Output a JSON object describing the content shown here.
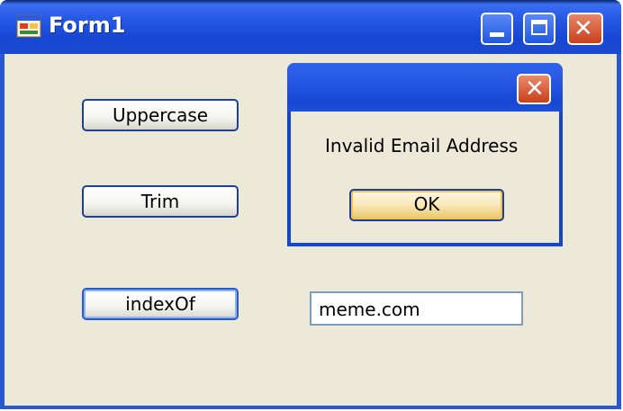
{
  "window": {
    "title": "Form1"
  },
  "buttons": {
    "uppercase": "Uppercase",
    "trim": "Trim",
    "indexof": "indexOf"
  },
  "textbox": {
    "value": "meme.com"
  },
  "dialog": {
    "message": "Invalid Email Address",
    "ok_label": "OK"
  },
  "colors": {
    "titlebar": "#2a5be6",
    "window_bg": "#ece9d8",
    "close_button": "#c8401c"
  },
  "icons": [
    "app-icon",
    "minimize-icon",
    "maximize-icon",
    "close-icon"
  ]
}
